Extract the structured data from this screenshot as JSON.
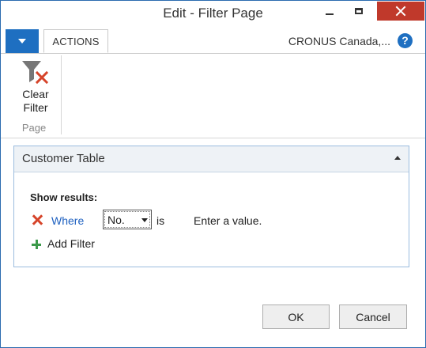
{
  "window": {
    "title": "Edit - Filter Page"
  },
  "ribbon": {
    "tab_label": "ACTIONS",
    "company": "CRONUS Canada,...",
    "help_glyph": "?",
    "clear_filter_line1": "Clear",
    "clear_filter_line2": "Filter",
    "group_label": "Page"
  },
  "fasttab": {
    "title": "Customer Table",
    "show_results_label": "Show results:",
    "filter": {
      "where_label": "Where",
      "field_value": "No.",
      "operator": "is",
      "value_placeholder": "Enter a value."
    },
    "add_filter_label": "Add Filter"
  },
  "footer": {
    "ok_label": "OK",
    "cancel_label": "Cancel"
  },
  "colors": {
    "accent": "#1e6fc1",
    "close_button": "#c0392b",
    "remove_icon": "#d6442a",
    "add_icon": "#3c9a4a",
    "link": "#1e60c0"
  }
}
